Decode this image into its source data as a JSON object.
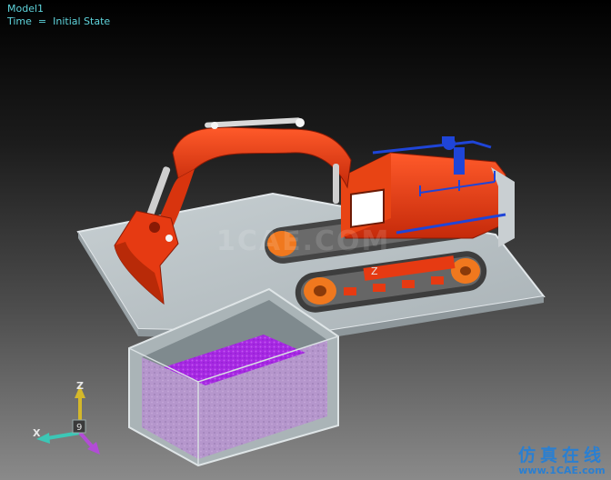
{
  "viewport": {
    "model_name": "Model1",
    "time_status": "Time  =  Initial State"
  },
  "watermark": {
    "text": "1CAE.COM"
  },
  "brand": {
    "chinese": "仿真在线",
    "url": "www.1CAE.com"
  },
  "axis_triad": {
    "z_label": "Z",
    "x_label": "X",
    "y_label": "9"
  },
  "colors": {
    "excavator_body": "#e63a12",
    "excavator_dark": "#a82008",
    "tracks": "#5a5a5a",
    "stripe": "#1f45d8",
    "platform": "#b9c1c5",
    "particles": "#b596cc",
    "particles_top": "#a628e2",
    "pit_wall": "#a4afb2"
  },
  "scene_label": {
    "z_marker": "Z"
  }
}
